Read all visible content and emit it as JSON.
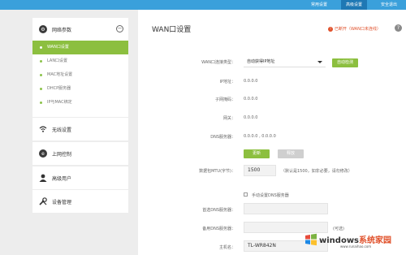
{
  "topbar": {
    "tabs": [
      {
        "label": "常用设置",
        "active": false
      },
      {
        "label": "高级设置",
        "active": true
      },
      {
        "label": "安全退出",
        "active": false
      }
    ]
  },
  "sidebar": {
    "network_group": {
      "label": "网络参数",
      "items": [
        "WAN口设置",
        "LAN口设置",
        "MAC地址设置",
        "DHCP服务器",
        "IP与MAC绑定"
      ]
    },
    "groups": [
      "无线设置",
      "上网控制",
      "高级用户",
      "设备管理"
    ]
  },
  "main": {
    "title": "WAN口设置",
    "status": "已断开（WAN口未连线）",
    "help": "?",
    "conn_type_label": "WAN口连接类型：",
    "conn_type_value": "自动获得IP地址",
    "auto_detect_label": "自动检测",
    "ip_label": "IP地址：",
    "ip_value": "0.0.0.0",
    "mask_label": "子网掩码：",
    "mask_value": "0.0.0.0",
    "gateway_label": "网关：",
    "gateway_value": "0.0.0.0",
    "dns_label": "DNS服务器：",
    "dns_value": "0.0.0.0 , 0.0.0.0",
    "renew_label": "更新",
    "release_label": "释放",
    "mtu_label": "数据包MTU(字节)：",
    "mtu_value": "1500",
    "mtu_hint": "（默认是1500，如非必要，请勿修改）",
    "manual_dns_label": "手动设置DNS服务器",
    "primary_dns_label": "首选DNS服务器：",
    "secondary_dns_label": "备用DNS服务器：",
    "optional_label": "(可选)",
    "hostname_label": "主机名：",
    "hostname_value": "TL-WR842N"
  },
  "watermark": {
    "brand_a": "windows",
    "brand_b": "系统家园",
    "url": "www.runaihao.com"
  }
}
